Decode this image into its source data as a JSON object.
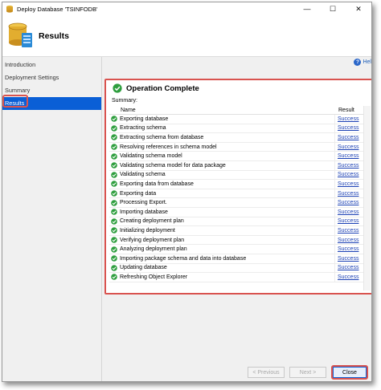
{
  "window": {
    "title": "Deploy Database 'TSINFODB'"
  },
  "titlebar_buttons": {
    "minimize": "—",
    "maximize": "☐",
    "close": "✕"
  },
  "header": {
    "title": "Results"
  },
  "sidebar": {
    "items": [
      {
        "label": "Introduction"
      },
      {
        "label": "Deployment Settings"
      },
      {
        "label": "Summary"
      },
      {
        "label": "Results"
      }
    ],
    "active": "Results"
  },
  "help": {
    "label": "Hel"
  },
  "operation": {
    "title": "Operation Complete",
    "summary_label": "Summary:"
  },
  "table": {
    "columns": [
      "Name",
      "Result"
    ],
    "rows": [
      {
        "name": "Exporting database",
        "result": "Success"
      },
      {
        "name": "Extracting schema",
        "result": "Success"
      },
      {
        "name": "Extracting schema from database",
        "result": "Success"
      },
      {
        "name": "Resolving references in schema model",
        "result": "Success"
      },
      {
        "name": "Validating schema model",
        "result": "Success"
      },
      {
        "name": "Validating schema model for data package",
        "result": "Success"
      },
      {
        "name": "Validating schema",
        "result": "Success"
      },
      {
        "name": "Exporting data from database",
        "result": "Success"
      },
      {
        "name": "Exporting data",
        "result": "Success"
      },
      {
        "name": "Processing Export.",
        "result": "Success"
      },
      {
        "name": "Importing database",
        "result": "Success"
      },
      {
        "name": "Creating deployment plan",
        "result": "Success"
      },
      {
        "name": "Initializing deployment",
        "result": "Success"
      },
      {
        "name": "Verifying deployment plan",
        "result": "Success"
      },
      {
        "name": "Analyzing deployment plan",
        "result": "Success"
      },
      {
        "name": "Importing package schema and data into database",
        "result": "Success"
      },
      {
        "name": "Updating database",
        "result": "Success"
      },
      {
        "name": "Refreshing Object Explorer",
        "result": "Success"
      }
    ]
  },
  "buttons": {
    "previous": "< Previous",
    "next": "Next >",
    "close": "Close"
  },
  "colors": {
    "accent": "#0a5fd6",
    "highlight": "#d9534f",
    "success_link": "#1a3fb3",
    "success_icon": "#2e9e3e"
  }
}
